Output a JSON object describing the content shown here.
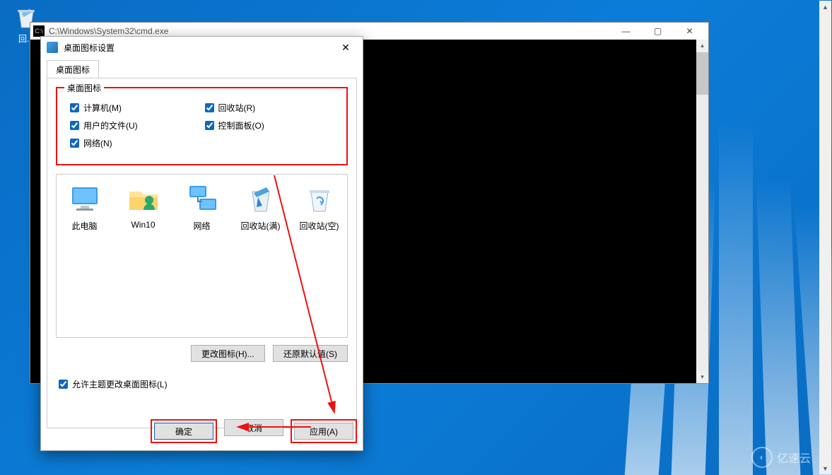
{
  "desktop": {
    "recycle_label": "回..."
  },
  "cmd": {
    "title": "C:\\Windows\\System32\\cmd.exe",
    "icon_text": "C:\\"
  },
  "dialog": {
    "title": "桌面图标设置",
    "tab_label": "桌面图标",
    "group_title": "桌面图标",
    "checks": {
      "computer": "计算机(M)",
      "recycle": "回收站(R)",
      "userfiles": "用户的文件(U)",
      "controlpanel": "控制面板(O)",
      "network": "网络(N)"
    },
    "icons": {
      "this_pc": "此电脑",
      "user": "Win10",
      "network": "网络",
      "recycle_full": "回收站(满)",
      "recycle_empty": "回收站(空)"
    },
    "buttons": {
      "change": "更改图标(H)...",
      "restore": "还原默认值(S)",
      "allow_themes": "允许主题更改桌面图标(L)",
      "ok": "确定",
      "cancel": "取消",
      "apply": "应用(A)"
    }
  },
  "watermark": "亿速云"
}
